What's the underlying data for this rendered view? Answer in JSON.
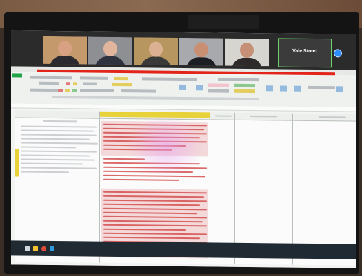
{
  "video_call": {
    "participants": [
      {
        "name": "",
        "tile_bg": "#c49a6c",
        "skin": "#d9a184",
        "clothes": "#2a2a30"
      },
      {
        "name": "",
        "tile_bg": "#8e8f92",
        "skin": "#e2b59d",
        "clothes": "#2f3340"
      },
      {
        "name": "",
        "tile_bg": "#b7975f",
        "skin": "#dcb093",
        "clothes": "#3a3a3a"
      },
      {
        "name": "",
        "tile_bg": "#a7a9ad",
        "skin": "#c98f73",
        "clothes": "#1d1d24"
      },
      {
        "name": "",
        "tile_bg": "#d6d5cf",
        "skin": "#c69077",
        "clothes": "#2f2a2a"
      },
      {
        "name": "Vale Street",
        "tile_bg": "#3b3b3b"
      }
    ],
    "indicator_color": "#e2241b",
    "accent_color": "#2d8cff"
  },
  "spreadsheet": {
    "app": "excel",
    "accent_color": "#21a34a",
    "highlight_color": "#e8d23a",
    "red_text_color": "#d03b3b"
  },
  "taskbar": {
    "icons": [
      "start-icon",
      "file-explorer-icon",
      "chrome-icon",
      "excel-icon"
    ]
  }
}
